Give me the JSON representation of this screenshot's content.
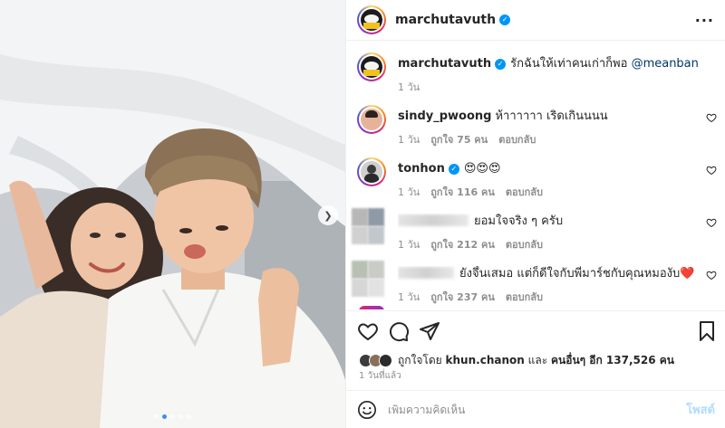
{
  "post": {
    "author": "marchutavuth",
    "author_avatar_text": "MARCH",
    "caption_text": "รักฉันให้เท่าคนเก่าก็พอ",
    "caption_mention": "@meanband",
    "caption_emojis": "❤️❤️🩹",
    "caption_time": "1 วัน",
    "likes_summary_prefix": "ถูกใจโดย",
    "likes_summary_user": "khun.chanon",
    "likes_summary_mid": "และ",
    "likes_summary_others": "คนอื่นๆ อีก 137,526 คน",
    "date": "1 วันที่แล้ว"
  },
  "comments": [
    {
      "username": "sindy_pwoong",
      "text": "ห้าาาาาา เริดเกินนนน",
      "time": "1 วัน",
      "likes": "ถูกใจ 75 คน",
      "reply": "ตอบกลับ",
      "verified": false
    },
    {
      "username": "tonhon",
      "text": "😍😍😍",
      "time": "1 วัน",
      "likes": "ถูกใจ 116 คน",
      "reply": "ตอบกลับ",
      "verified": true
    },
    {
      "username": "",
      "text": "ยอมใจจริง ๆ ครับ",
      "time": "1 วัน",
      "likes": "ถูกใจ 212 คน",
      "reply": "ตอบกลับ",
      "verified": false
    },
    {
      "username": "",
      "text": "ยังจึ้นเสมอ แต่ก็ดีใจกับพี่มาร์ชกับคุณหมองับ❤️",
      "time": "1 วัน",
      "likes": "ถูกใจ 237 คน",
      "reply": "ตอบกลับ",
      "verified": false
    }
  ],
  "composer": {
    "placeholder": "เพิ่มความคิดเห็น",
    "post_label": "โพสต์"
  },
  "icons": {
    "more": "more-icon",
    "like": "heart-icon",
    "comment": "comment-icon",
    "share": "send-icon",
    "save": "bookmark-icon",
    "emoji": "emoji-icon",
    "carousel_next": "chevron-right-icon"
  },
  "colors": {
    "verified": "#0095f6",
    "link": "#00376b",
    "post_button_disabled": "#b3dbff",
    "active_dot": "#3b8ff0"
  }
}
